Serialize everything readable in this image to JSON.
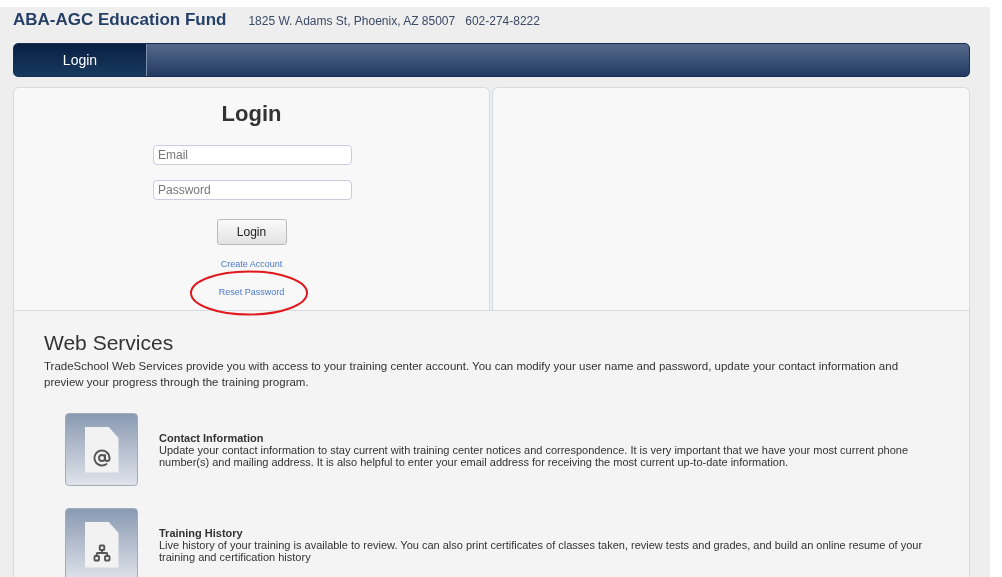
{
  "header": {
    "title": "ABA-AGC Education Fund",
    "address": "1825 W. Adams St, Phoenix, AZ 85007",
    "phone": "602-274-8222"
  },
  "nav": {
    "tabs": [
      {
        "label": "Login",
        "selected": true
      }
    ]
  },
  "login": {
    "title": "Login",
    "fields": [
      {
        "placeholder": "Email"
      },
      {
        "placeholder": "Password"
      }
    ],
    "button": "Login",
    "links": [
      {
        "label": "Create Account",
        "highlighted": false
      },
      {
        "label": "Reset Password",
        "highlighted": true
      }
    ]
  },
  "services": {
    "title": "Web Services",
    "intro": "TradeSchool Web Services provide you with access to your training center account. You can modify your user name and password, update your contact information and preview your progress through the training program.",
    "items": [
      {
        "kind": "email",
        "title": "Contact Information",
        "text": "Update your contact information to stay current with training center notices and correspondence. It is very important that we have your most current phone number(s) and mailing address. It is also helpful to enter your email address for receiving the most current up-to-date information."
      },
      {
        "kind": "history",
        "title": "Training History",
        "text": "Live history of your training is available to review. You can also print certificates of classes taken, review tests and grades, and build an online resume of your training and certification history"
      }
    ]
  }
}
